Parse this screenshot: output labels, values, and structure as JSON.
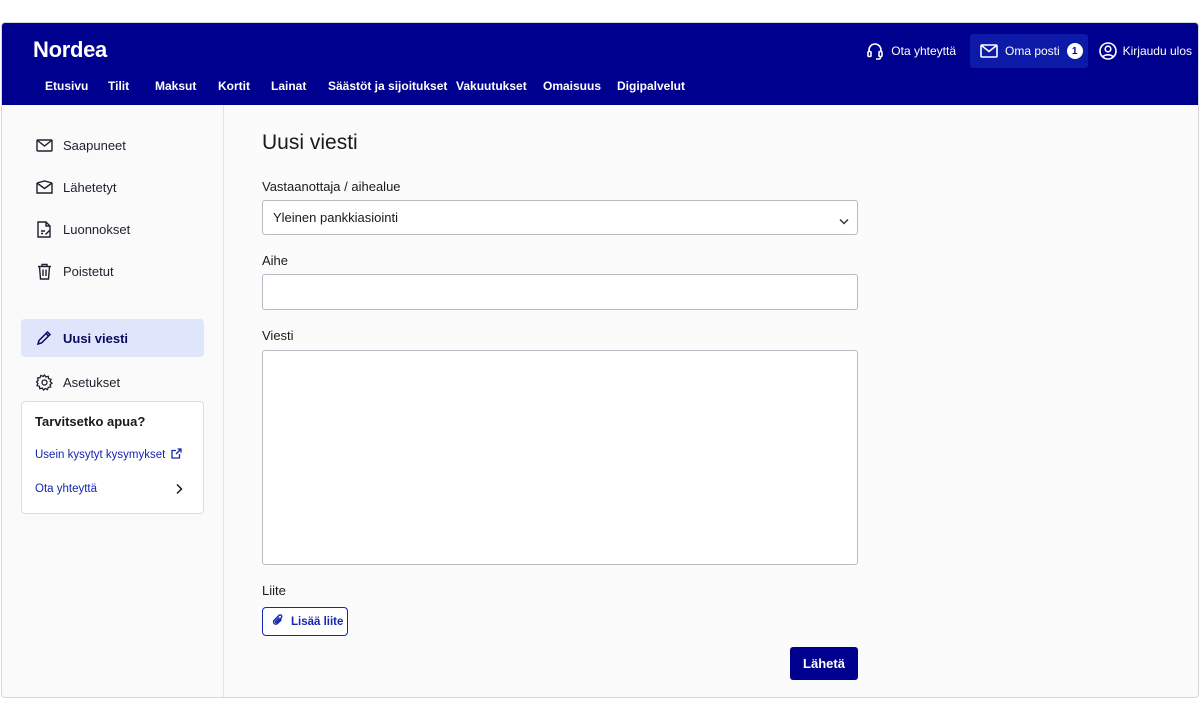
{
  "header": {
    "logo": "Nordea",
    "nav": [
      {
        "label": "Etusivu"
      },
      {
        "label": "Tilit"
      },
      {
        "label": "Maksut"
      },
      {
        "label": "Kortit"
      },
      {
        "label": "Lainat"
      },
      {
        "label": "Säästöt ja sijoitukset"
      },
      {
        "label": "Vakuutukset"
      },
      {
        "label": "Omaisuus"
      },
      {
        "label": "Digipalvelut"
      }
    ],
    "contact_label": "Ota yhteyttä",
    "mail_label": "Oma posti",
    "mail_count": "1",
    "login_label": "Kirjaudu ulos"
  },
  "sidebar": {
    "items": [
      {
        "label": "Saapuneet",
        "icon": "envelope-icon"
      },
      {
        "label": "Lähetetyt",
        "icon": "sent-envelope-icon"
      },
      {
        "label": "Luonnokset",
        "icon": "draft-document-icon"
      },
      {
        "label": "Poistetut",
        "icon": "trash-icon"
      },
      {
        "label": "Uusi viesti",
        "icon": "pencil-icon",
        "active": true
      },
      {
        "label": "Asetukset",
        "icon": "gear-icon"
      }
    ],
    "help": {
      "title": "Tarvitsetko apua?",
      "faq_label": "Usein kysytyt kysymykset",
      "contact_label": "Ota yhteyttä"
    }
  },
  "main": {
    "title": "Uusi viesti",
    "recipient_label": "Vastaanottaja / aihealue",
    "recipient_value": "Yleinen pankkiasiointi",
    "subject_label": "Aihe",
    "subject_value": "",
    "message_label": "Viesti",
    "message_value": "",
    "attachment_label": "Liite",
    "add_attachment_label": "Lisää liite",
    "send_label": "Lähetä"
  },
  "colors": {
    "brand": "#00008f",
    "link": "#1426b4",
    "active_bg": "#dfe6fb"
  }
}
